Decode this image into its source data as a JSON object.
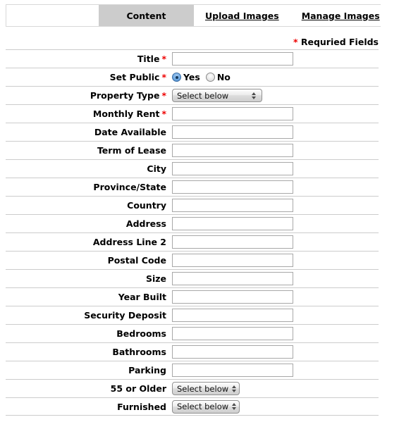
{
  "tabs": {
    "spacer_label": "",
    "items": [
      {
        "label": "Content",
        "state": "active"
      },
      {
        "label": "Upload Images",
        "state": "link"
      },
      {
        "label": "Manage Images",
        "state": "link"
      }
    ]
  },
  "required_note": {
    "asterisk": "*",
    "text": "Requried Fields"
  },
  "colors": {
    "asterisk_red": "#ee0000",
    "active_tab_gray": "#cccccc",
    "row_divider": "#cccccc"
  },
  "form": {
    "select_placeholder": "Select below",
    "rows": [
      {
        "label": "Title",
        "required": true,
        "control": "text",
        "value": ""
      },
      {
        "label": "Set Public",
        "required": true,
        "control": "radio",
        "value": "Yes",
        "options": [
          {
            "label": "Yes",
            "selected": true
          },
          {
            "label": "No",
            "selected": false
          }
        ]
      },
      {
        "label": "Property Type",
        "required": true,
        "control": "select-wide",
        "value": "Select below"
      },
      {
        "label": "Monthly Rent",
        "required": true,
        "control": "text",
        "value": ""
      },
      {
        "label": "Date Available",
        "required": false,
        "control": "text",
        "value": ""
      },
      {
        "label": "Term of Lease",
        "required": false,
        "control": "text",
        "value": ""
      },
      {
        "label": "City",
        "required": false,
        "control": "text",
        "value": ""
      },
      {
        "label": "Province/State",
        "required": false,
        "control": "text",
        "value": ""
      },
      {
        "label": "Country",
        "required": false,
        "control": "text",
        "value": ""
      },
      {
        "label": "Address",
        "required": false,
        "control": "text",
        "value": ""
      },
      {
        "label": "Address Line 2",
        "required": false,
        "control": "text",
        "value": ""
      },
      {
        "label": "Postal Code",
        "required": false,
        "control": "text",
        "value": ""
      },
      {
        "label": "Size",
        "required": false,
        "control": "text",
        "value": ""
      },
      {
        "label": "Year Built",
        "required": false,
        "control": "text",
        "value": ""
      },
      {
        "label": "Security Deposit",
        "required": false,
        "control": "text",
        "value": ""
      },
      {
        "label": "Bedrooms",
        "required": false,
        "control": "text",
        "value": ""
      },
      {
        "label": "Bathrooms",
        "required": false,
        "control": "text",
        "value": ""
      },
      {
        "label": "Parking",
        "required": false,
        "control": "text",
        "value": ""
      },
      {
        "label": "55 or Older",
        "required": false,
        "control": "select-narrow",
        "value": "Select below"
      },
      {
        "label": "Furnished",
        "required": false,
        "control": "select-narrow",
        "value": "Select below"
      }
    ]
  }
}
